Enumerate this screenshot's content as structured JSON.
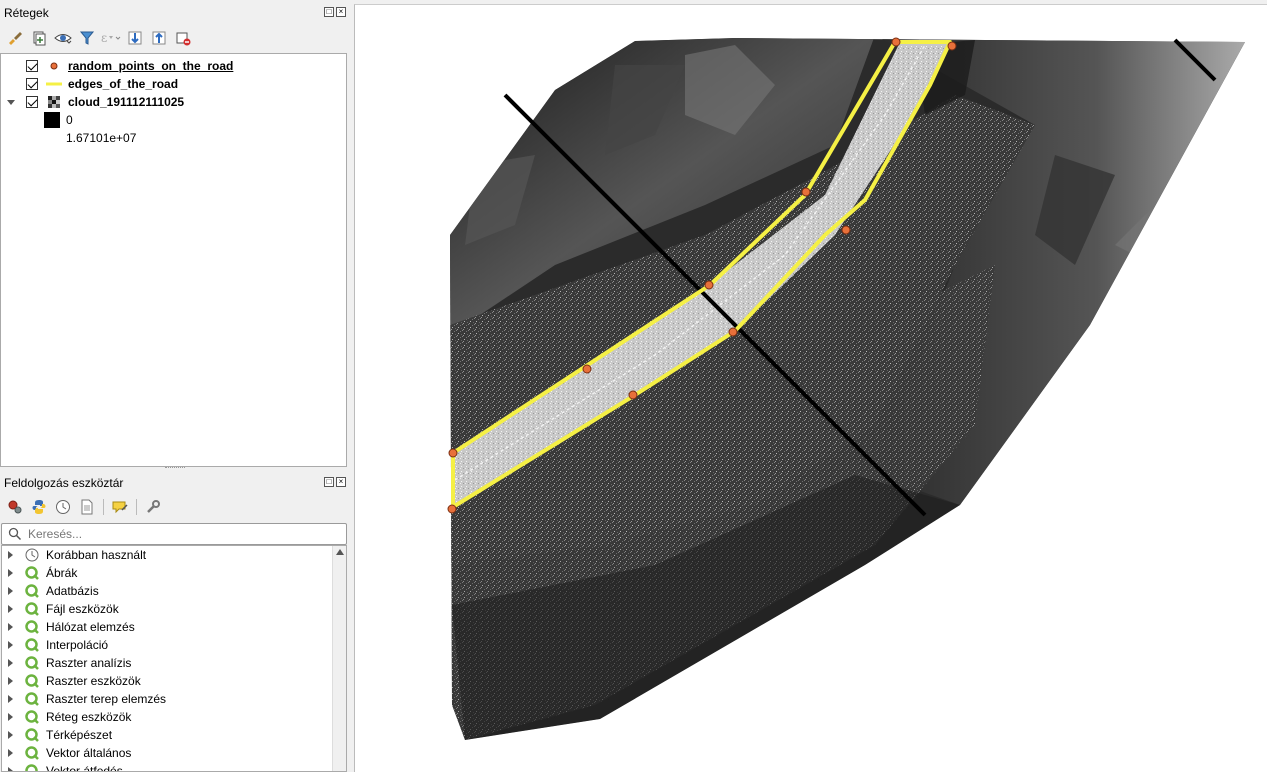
{
  "layers_panel": {
    "title": "Rétegek",
    "layers": [
      {
        "name": "random_points_on_the_road",
        "checked": true,
        "active": true,
        "symbol": "point-symbol-icon"
      },
      {
        "name": "edges_of_the_road",
        "checked": true,
        "active": false,
        "symbol": "line-symbol-icon"
      },
      {
        "name": "cloud_191112111025",
        "checked": true,
        "active": false,
        "symbol": "raster-symbol-icon",
        "legend": {
          "min_label": "0",
          "max_label": "1.67101e+07"
        }
      }
    ]
  },
  "processing_panel": {
    "title": "Feldolgozás eszköztár",
    "search_placeholder": "Keresés...",
    "items": [
      {
        "label": "Korábban használt",
        "icon": "clock-icon"
      },
      {
        "label": "Ábrák",
        "icon": "qgis-logo-icon"
      },
      {
        "label": "Adatbázis",
        "icon": "qgis-logo-icon"
      },
      {
        "label": "Fájl eszközök",
        "icon": "qgis-logo-icon"
      },
      {
        "label": "Hálózat elemzés",
        "icon": "qgis-logo-icon"
      },
      {
        "label": "Interpoláció",
        "icon": "qgis-logo-icon"
      },
      {
        "label": "Raszter analízis",
        "icon": "qgis-logo-icon"
      },
      {
        "label": "Raszter eszközök",
        "icon": "qgis-logo-icon"
      },
      {
        "label": "Raszter terep elemzés",
        "icon": "qgis-logo-icon"
      },
      {
        "label": "Réteg eszközök",
        "icon": "qgis-logo-icon"
      },
      {
        "label": "Térképészet",
        "icon": "qgis-logo-icon"
      },
      {
        "label": "Vektor általános",
        "icon": "qgis-logo-icon"
      },
      {
        "label": "Vektor átfedés",
        "icon": "qgis-logo-icon"
      }
    ]
  },
  "colors": {
    "road_edge": "#f5f045",
    "point_fill": "#e8703a",
    "point_stroke": "#7a2e12",
    "section_line": "#000000",
    "qgis_green": "#6cb33f"
  }
}
